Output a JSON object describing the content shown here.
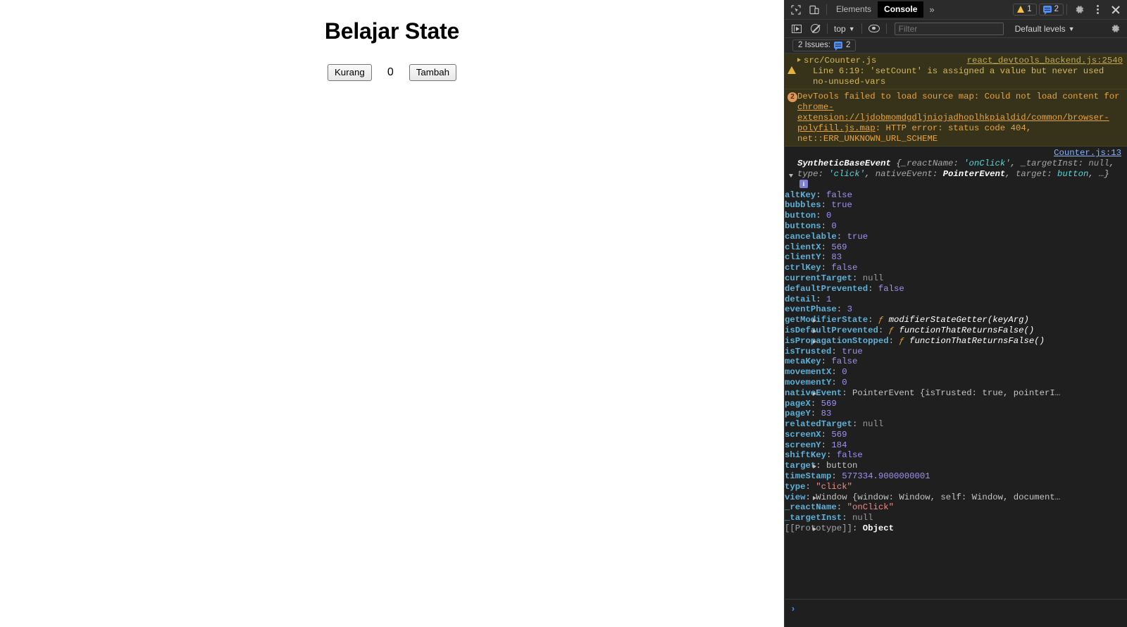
{
  "page": {
    "title": "Belajar State",
    "decrement_label": "Kurang",
    "counter_value": "0",
    "increment_label": "Tambah"
  },
  "devtools": {
    "tabs": [
      {
        "label": "Elements",
        "active": false
      },
      {
        "label": "Console",
        "active": true
      }
    ],
    "more_tabs_glyph": "»",
    "warning_count": "1",
    "message_count": "2",
    "toolbar": {
      "context_label": "top",
      "caret": "▼",
      "filter_placeholder": "Filter",
      "filter_value": "",
      "levels_label": "Default levels"
    },
    "issues": {
      "label": "2 Issues:",
      "count": "2"
    },
    "colors": {
      "panel_bg": "#242424",
      "console_bg": "#1f1f1f",
      "warning_bg": "#37331a",
      "warning_text": "#d4b85a",
      "error_text": "#e8a33d",
      "link_blue": "#8ab4f8",
      "prop_name": "#5db0d7",
      "value_purple": "#a191f3",
      "value_string": "#f28b82",
      "accent_blue": "#4d8ff7"
    },
    "messages": [
      {
        "kind": "warning",
        "source": "src/Counter.js",
        "link": "react_devtools_backend.js:2540",
        "detail": "Line 6:19:  'setCount' is assigned a value but never used  no-unused-vars"
      },
      {
        "kind": "error",
        "badge": "2",
        "text_before": "DevTools failed to load source map: Could not load content for ",
        "url": "chrome-extension://ljdobmomdgdljniojadhoplhkpialdid/common/browser-polyfill.js.map",
        "text_after": ": HTTP error: status code 404, net::ERR_UNKNOWN_URL_SCHEME"
      }
    ],
    "object_log": {
      "source_link": "Counter.js:13",
      "preview": {
        "class_name": "SyntheticBaseEvent",
        "open_brace": "{",
        "segments": [
          {
            "key": "_reactName",
            "value": "'onClick'",
            "type": "string"
          },
          {
            "key": "_targetInst",
            "value": "null",
            "type": "null"
          },
          {
            "key": "type",
            "value": "'click'",
            "type": "string"
          },
          {
            "key": "nativeEvent",
            "value": "PointerEvent",
            "type": "bold"
          },
          {
            "key": "target",
            "value": "button",
            "type": "plain"
          }
        ],
        "ellipsis": "…}",
        "info_badge": "i"
      },
      "properties": [
        {
          "name": "altKey",
          "value": "false",
          "type": "bool",
          "expandable": false
        },
        {
          "name": "bubbles",
          "value": "true",
          "type": "bool",
          "expandable": false
        },
        {
          "name": "button",
          "value": "0",
          "type": "num",
          "expandable": false
        },
        {
          "name": "buttons",
          "value": "0",
          "type": "num",
          "expandable": false
        },
        {
          "name": "cancelable",
          "value": "true",
          "type": "bool",
          "expandable": false
        },
        {
          "name": "clientX",
          "value": "569",
          "type": "num",
          "expandable": false
        },
        {
          "name": "clientY",
          "value": "83",
          "type": "num",
          "expandable": false
        },
        {
          "name": "ctrlKey",
          "value": "false",
          "type": "bool",
          "expandable": false
        },
        {
          "name": "currentTarget",
          "value": "null",
          "type": "null",
          "expandable": false
        },
        {
          "name": "defaultPrevented",
          "value": "false",
          "type": "bool",
          "expandable": false
        },
        {
          "name": "detail",
          "value": "1",
          "type": "num",
          "expandable": false
        },
        {
          "name": "eventPhase",
          "value": "3",
          "type": "num",
          "expandable": false
        },
        {
          "name": "getModifierState",
          "value": "modifierStateGetter(keyArg)",
          "type": "fn",
          "expandable": true
        },
        {
          "name": "isDefaultPrevented",
          "value": "functionThatReturnsFalse()",
          "type": "fn",
          "expandable": true
        },
        {
          "name": "isPropagationStopped",
          "value": "functionThatReturnsFalse()",
          "type": "fn",
          "expandable": true
        },
        {
          "name": "isTrusted",
          "value": "true",
          "type": "bool",
          "expandable": false
        },
        {
          "name": "metaKey",
          "value": "false",
          "type": "bool",
          "expandable": false
        },
        {
          "name": "movementX",
          "value": "0",
          "type": "num",
          "expandable": false
        },
        {
          "name": "movementY",
          "value": "0",
          "type": "num",
          "expandable": false
        },
        {
          "name": "nativeEvent",
          "value": "PointerEvent {isTrusted: true, pointerI…",
          "type": "objpreview",
          "expandable": true
        },
        {
          "name": "pageX",
          "value": "569",
          "type": "num",
          "expandable": false
        },
        {
          "name": "pageY",
          "value": "83",
          "type": "num",
          "expandable": false
        },
        {
          "name": "relatedTarget",
          "value": "null",
          "type": "null",
          "expandable": false
        },
        {
          "name": "screenX",
          "value": "569",
          "type": "num",
          "expandable": false
        },
        {
          "name": "screenY",
          "value": "184",
          "type": "num",
          "expandable": false
        },
        {
          "name": "shiftKey",
          "value": "false",
          "type": "bool",
          "expandable": false
        },
        {
          "name": "target",
          "value": "button",
          "type": "plain",
          "expandable": true
        },
        {
          "name": "timeStamp",
          "value": "577334.9000000001",
          "type": "num",
          "expandable": false
        },
        {
          "name": "type",
          "value": "\"click\"",
          "type": "str",
          "expandable": false
        },
        {
          "name": "view",
          "value": "Window {window: Window, self: Window, document…",
          "type": "objpreview",
          "expandable": true
        },
        {
          "name": "_reactName",
          "value": "\"onClick\"",
          "type": "str",
          "expandable": false
        },
        {
          "name": "_targetInst",
          "value": "null",
          "type": "null",
          "expandable": false
        },
        {
          "name": "[[Prototype]]",
          "value": "Object",
          "type": "objbold",
          "expandable": true,
          "internal": true
        }
      ]
    },
    "prompt_glyph": "›"
  }
}
